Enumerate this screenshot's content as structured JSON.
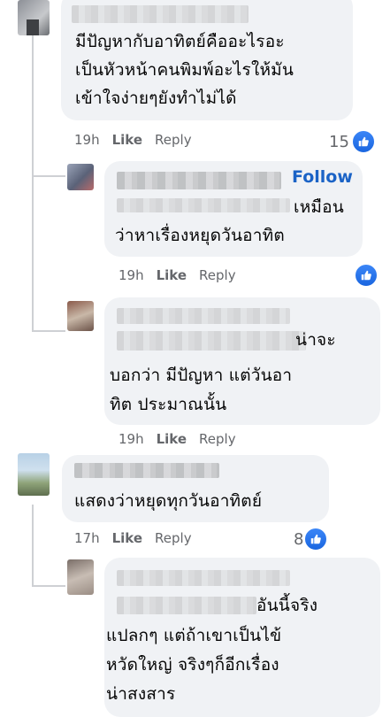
{
  "comments": [
    {
      "id": "c1",
      "text_lines": [
        "มีปัญหากับอาทิตย์คืออะไรอะ",
        "เป็นหัวหน้าคนพิมพ์อะไรให้มัน",
        "เข้าใจง่ายๆยังทำไม่ได้"
      ],
      "time": "19h",
      "like_label": "Like",
      "reply_label": "Reply",
      "reaction_count": "15",
      "reaction_icon": "like-reaction-icon"
    },
    {
      "id": "c2",
      "follow_label": "Follow",
      "text_lines": [
        "เหมือน",
        "ว่าหาเรื่องหยุดวันอาทิต"
      ],
      "time": "19h",
      "like_label": "Like",
      "reply_label": "Reply",
      "reaction_count": "",
      "reaction_icon": "like-reaction-icon"
    },
    {
      "id": "c3",
      "text_lines": [
        "น่าจะ",
        "บอกว่า มีปัญหา แต่วันอา",
        "ทิต ประมาณนั้น"
      ],
      "time": "19h",
      "like_label": "Like",
      "reply_label": "Reply"
    },
    {
      "id": "c4",
      "text_lines": [
        "แสดงว่าหยุดทุกวันอาทิตย์"
      ],
      "time": "17h",
      "like_label": "Like",
      "reply_label": "Reply",
      "reaction_count": "8",
      "reaction_icon": "like-reaction-icon"
    },
    {
      "id": "c5",
      "text_lines": [
        "อันนี้จริง",
        "แปลกๆ แต่ถ้าเขาเป็นไข้",
        "หวัดใหญ่ จริงๆก็อีกเรื่อง",
        "น่าสงสาร"
      ]
    }
  ],
  "colors": {
    "bubble": "#f0f2f5",
    "meta_text": "#65676b",
    "follow": "#1b63c6",
    "reaction_blue": "#1877f2",
    "thread_line": "#ced0d4"
  }
}
